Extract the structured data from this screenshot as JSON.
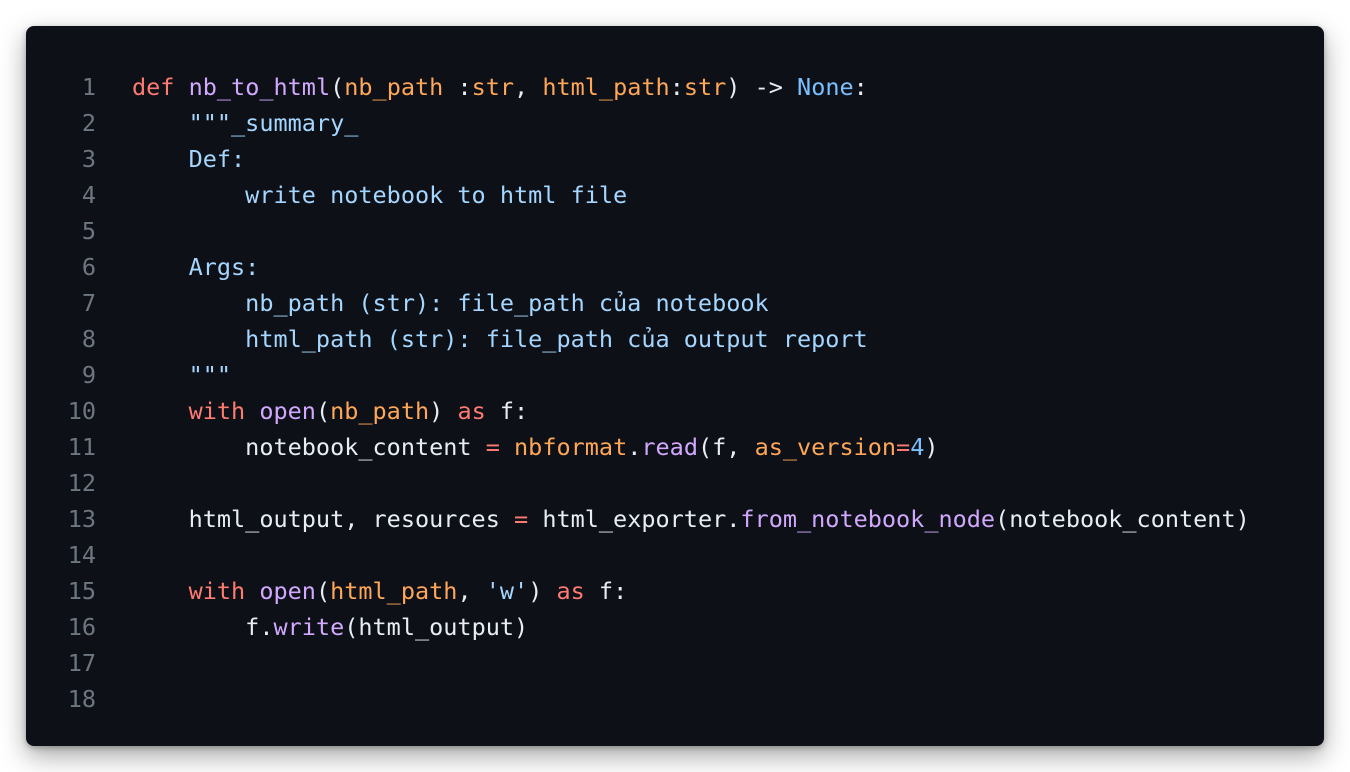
{
  "colors": {
    "background": "#0d1117",
    "line_number": "#6e7681",
    "keyword": "#ff7b72",
    "function": "#d2a8ff",
    "parameter": "#ffa657",
    "plain": "#e6edf3",
    "builtin": "#79c0ff",
    "docstring": "#a5d6ff"
  },
  "lines": [
    {
      "n": "1",
      "tokens": [
        {
          "t": "def",
          "c": "kw"
        },
        {
          "t": " ",
          "c": "plain"
        },
        {
          "t": "nb_to_html",
          "c": "fn"
        },
        {
          "t": "(",
          "c": "plain"
        },
        {
          "t": "nb_path",
          "c": "param"
        },
        {
          "t": " :",
          "c": "plain"
        },
        {
          "t": "str",
          "c": "param"
        },
        {
          "t": ", ",
          "c": "plain"
        },
        {
          "t": "html_path",
          "c": "param"
        },
        {
          "t": ":",
          "c": "plain"
        },
        {
          "t": "str",
          "c": "param"
        },
        {
          "t": ") -> ",
          "c": "plain"
        },
        {
          "t": "None",
          "c": "builtin"
        },
        {
          "t": ":",
          "c": "plain"
        }
      ]
    },
    {
      "n": "2",
      "tokens": [
        {
          "t": "    \"\"\"_summary_",
          "c": "doc"
        }
      ]
    },
    {
      "n": "3",
      "tokens": [
        {
          "t": "    Def:",
          "c": "doc"
        }
      ]
    },
    {
      "n": "4",
      "tokens": [
        {
          "t": "        write notebook to html file",
          "c": "doc"
        }
      ]
    },
    {
      "n": "5",
      "tokens": []
    },
    {
      "n": "6",
      "tokens": [
        {
          "t": "    Args:",
          "c": "doc"
        }
      ]
    },
    {
      "n": "7",
      "tokens": [
        {
          "t": "        nb_path (str): file_path của notebook",
          "c": "doc"
        }
      ]
    },
    {
      "n": "8",
      "tokens": [
        {
          "t": "        html_path (str): file_path của output report",
          "c": "doc"
        }
      ]
    },
    {
      "n": "9",
      "tokens": [
        {
          "t": "    \"\"\"",
          "c": "doc"
        }
      ]
    },
    {
      "n": "10",
      "tokens": [
        {
          "t": "    ",
          "c": "plain"
        },
        {
          "t": "with",
          "c": "kw"
        },
        {
          "t": " ",
          "c": "plain"
        },
        {
          "t": "open",
          "c": "fn"
        },
        {
          "t": "(",
          "c": "plain"
        },
        {
          "t": "nb_path",
          "c": "param"
        },
        {
          "t": ") ",
          "c": "plain"
        },
        {
          "t": "as",
          "c": "kw"
        },
        {
          "t": " f:",
          "c": "plain"
        }
      ]
    },
    {
      "n": "11",
      "tokens": [
        {
          "t": "        notebook_content ",
          "c": "plain"
        },
        {
          "t": "=",
          "c": "op"
        },
        {
          "t": " ",
          "c": "plain"
        },
        {
          "t": "nbformat",
          "c": "param"
        },
        {
          "t": ".",
          "c": "plain"
        },
        {
          "t": "read",
          "c": "fn"
        },
        {
          "t": "(f, ",
          "c": "plain"
        },
        {
          "t": "as_version",
          "c": "param"
        },
        {
          "t": "=",
          "c": "op"
        },
        {
          "t": "4",
          "c": "num"
        },
        {
          "t": ")",
          "c": "plain"
        }
      ]
    },
    {
      "n": "12",
      "tokens": []
    },
    {
      "n": "13",
      "tokens": [
        {
          "t": "    html_output, resources ",
          "c": "plain"
        },
        {
          "t": "=",
          "c": "op"
        },
        {
          "t": " html_exporter.",
          "c": "plain"
        },
        {
          "t": "from_notebook_node",
          "c": "fn"
        },
        {
          "t": "(notebook_content)",
          "c": "plain"
        }
      ]
    },
    {
      "n": "14",
      "tokens": []
    },
    {
      "n": "15",
      "tokens": [
        {
          "t": "    ",
          "c": "plain"
        },
        {
          "t": "with",
          "c": "kw"
        },
        {
          "t": " ",
          "c": "plain"
        },
        {
          "t": "open",
          "c": "fn"
        },
        {
          "t": "(",
          "c": "plain"
        },
        {
          "t": "html_path",
          "c": "param"
        },
        {
          "t": ", ",
          "c": "plain"
        },
        {
          "t": "'w'",
          "c": "str"
        },
        {
          "t": ") ",
          "c": "plain"
        },
        {
          "t": "as",
          "c": "kw"
        },
        {
          "t": " f:",
          "c": "plain"
        }
      ]
    },
    {
      "n": "16",
      "tokens": [
        {
          "t": "        f.",
          "c": "plain"
        },
        {
          "t": "write",
          "c": "fn"
        },
        {
          "t": "(html_output)",
          "c": "plain"
        }
      ]
    },
    {
      "n": "17",
      "tokens": []
    },
    {
      "n": "18",
      "tokens": []
    }
  ]
}
